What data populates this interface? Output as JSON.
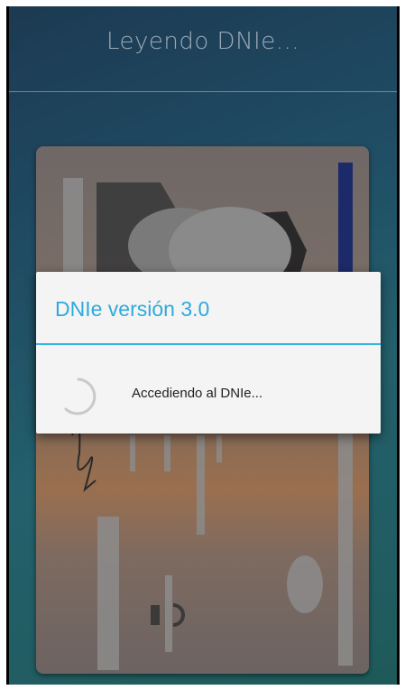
{
  "header": {
    "title": "Leyendo DNIe..."
  },
  "dialog": {
    "title": "DNIe versión 3.0",
    "message": "Accediendo al DNIe..."
  },
  "colors": {
    "accent": "#33b5e5",
    "background_top": "#1c3a52",
    "background_bottom": "#1f5a5a"
  },
  "icons": {
    "progress": "spinner-icon"
  }
}
